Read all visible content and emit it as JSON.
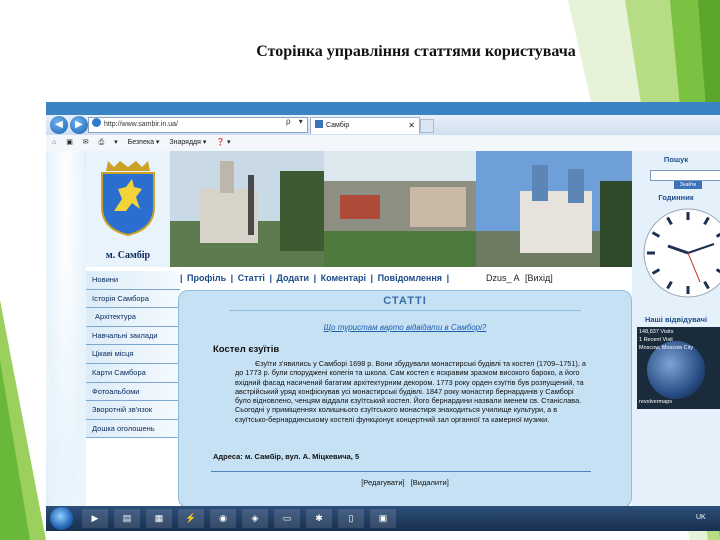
{
  "slide": {
    "title": "Сторінка управління статтями користувача"
  },
  "browser": {
    "url": "http://www.sambir.in.ua/",
    "address_controls": "ρ ▾ ↻ ✕",
    "tab_title": "Самбір",
    "toolbar": [
      "Безпека ▾",
      "Знаряддя ▾",
      "❓ ▾"
    ]
  },
  "site": {
    "city_name": "м. Самбір",
    "menu": [
      "Профіль",
      "Статті",
      "Додати",
      "Коментарі",
      "Повідомлення"
    ],
    "menu_sep": "|",
    "username": "Dzus_ A",
    "exit": "[Вихід]",
    "leftnav": [
      "Новини",
      "Історія Самбора",
      "Архітектура",
      "Навчальні заклади",
      "Цікаві місця",
      "Карти Самбора",
      "Фотоальбоми",
      "Зворотній зв'язок",
      "Дошка оголошень"
    ]
  },
  "article": {
    "section_title": "СТАТТІ",
    "subtitle": "Що туристам варто відвідати в Самборі?",
    "heading": "Костел єзуїтів",
    "body": "Єзуїти з'явились у Самборі 1698 р. Вони збудували монастирські будівлі та костел (1709–1751), а до 1773 р. були споруджені колегія та школа. Сам костел є яскравим зразком високого бароко, а його вхідний фасад насичений багатим архітектурним декором. 1773 року орден єзуїтів був розпущений, та австрійський уряд конфіскував усі монастирські будівлі. 1847 року монастир бернардинів у Самборі було відновлено, ченцям віддали єзуїтський костел. Його бернардини назвали іменем св. Станіслава. Сьогодні у приміщеннях колишнього єзуїтського монастиря знаходиться училище культури, а в єзуїтсько-бернардинському костелі функціонує концертний зал органної та камерної музики.",
    "address": "Адреса: м. Самбір, вул. А. Міцкевича, 5",
    "edit": "[Редагувати]",
    "delete": "[Видалити]"
  },
  "sidebar": {
    "search_heading": "Пошук",
    "search_button": "Знайти",
    "clock_heading": "Годинник",
    "visitors_heading": "Наші відвідувачі",
    "visitors_line1": "148,837 Visits",
    "visitors_line2": "1 Recent Visit",
    "visitors_line3": "Moscow, Moscow City",
    "visitors_footer": "revolvermaps"
  },
  "taskbar": {
    "tray_text": "UK"
  },
  "colors": {
    "accent": "#3b84c4",
    "green": "#7cc242",
    "link": "#1b4b88"
  }
}
